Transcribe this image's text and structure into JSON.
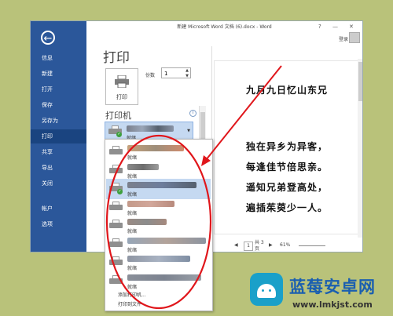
{
  "window": {
    "title": "新建 Microsoft Word 文档 (6).docx - Word",
    "help": "?",
    "minimize": "—",
    "close": "✕",
    "login": "登录"
  },
  "sidebar": {
    "back": "←",
    "items": [
      {
        "label": "信息"
      },
      {
        "label": "新建"
      },
      {
        "label": "打开"
      },
      {
        "label": "保存"
      },
      {
        "label": "另存为"
      },
      {
        "label": "打印"
      },
      {
        "label": "共享"
      },
      {
        "label": "导出"
      },
      {
        "label": "关闭"
      },
      {
        "label": "帐户"
      },
      {
        "label": "选项"
      }
    ],
    "active": "打印"
  },
  "print": {
    "title": "打印",
    "button_label": "打印",
    "copies_label": "份数",
    "copies_value": "1",
    "printer_heading": "打印机",
    "info_icon": "i",
    "selected_status": "就绪"
  },
  "printer_list": {
    "items": [
      {
        "status": "就绪",
        "default": false,
        "selected": false,
        "swatch": [
          "#c7a27c",
          "#9e8e7a",
          "#d08c6e"
        ]
      },
      {
        "status": "就绪",
        "default": false,
        "selected": false,
        "swatch": [
          "#8a8a8a",
          "#6d6d6d",
          "#9c9c9c"
        ]
      },
      {
        "status": "就绪",
        "default": true,
        "selected": true,
        "swatch": [
          "#7a7f8c",
          "#6d7d9c",
          "#55606e"
        ]
      },
      {
        "status": "就绪",
        "default": false,
        "selected": false,
        "swatch": [
          "#c49a8a",
          "#d2a79b",
          "#b88a7c"
        ]
      },
      {
        "status": "就绪",
        "default": false,
        "selected": false,
        "swatch": [
          "#9a8b84",
          "#8c8c8c",
          "#a68a7e"
        ]
      },
      {
        "status": "就绪",
        "default": false,
        "selected": false,
        "swatch": [
          "#97a6b8",
          "#b3a39a",
          "#8c94a0"
        ]
      },
      {
        "status": "就绪",
        "default": false,
        "selected": false,
        "swatch": [
          "#8f96a3",
          "#a8b2c2",
          "#7f8ea3"
        ]
      },
      {
        "status": "就绪",
        "default": false,
        "selected": false,
        "swatch": [
          "#8a8f99",
          "#7c8390",
          "#9aa0a8"
        ]
      }
    ],
    "add_printer": "添加打印机...",
    "print_to_file": "打印到文件"
  },
  "preview": {
    "lines": [
      "九月九日忆山东兄",
      "独在异乡为异客，",
      "每逢佳节倍思亲。",
      "遥知兄弟登高处，",
      "遍插茱萸少一人。"
    ],
    "page_current": "1",
    "page_total": "共 3 页",
    "zoom": "61%",
    "prev": "◀",
    "next": "▶"
  },
  "watermark": {
    "title": "蓝莓安卓网",
    "url": "www.lmkjst.com"
  },
  "colors": {
    "sidebar": "#2b579a",
    "annotation": "#e0161b",
    "selection": "#c5d9f1"
  }
}
